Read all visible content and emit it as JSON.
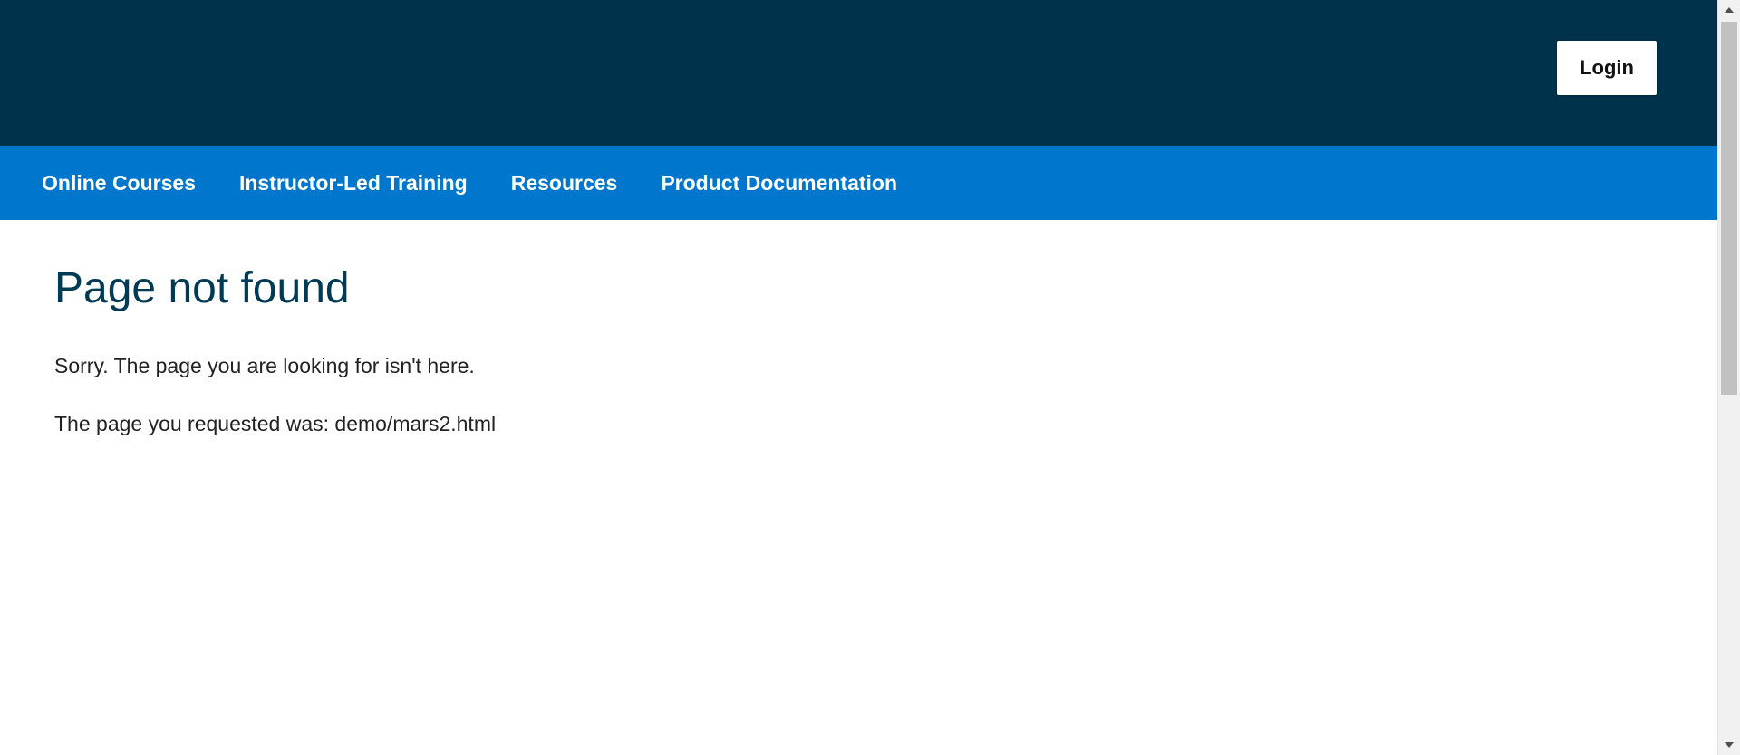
{
  "header": {
    "login_label": "Login",
    "background_color": "#00324b"
  },
  "nav": {
    "background_color": "#0076cc",
    "items": [
      {
        "label": "Online Courses"
      },
      {
        "label": "Instructor-Led Training"
      },
      {
        "label": "Resources"
      },
      {
        "label": "Product Documentation"
      }
    ]
  },
  "main": {
    "title": "Page not found",
    "message": "Sorry. The page you are looking for isn't here.",
    "requested_text": "The page you requested was: demo/mars2.html"
  },
  "scrollbar": {
    "up_icon": "triangle-up-icon",
    "down_icon": "triangle-down-icon"
  }
}
